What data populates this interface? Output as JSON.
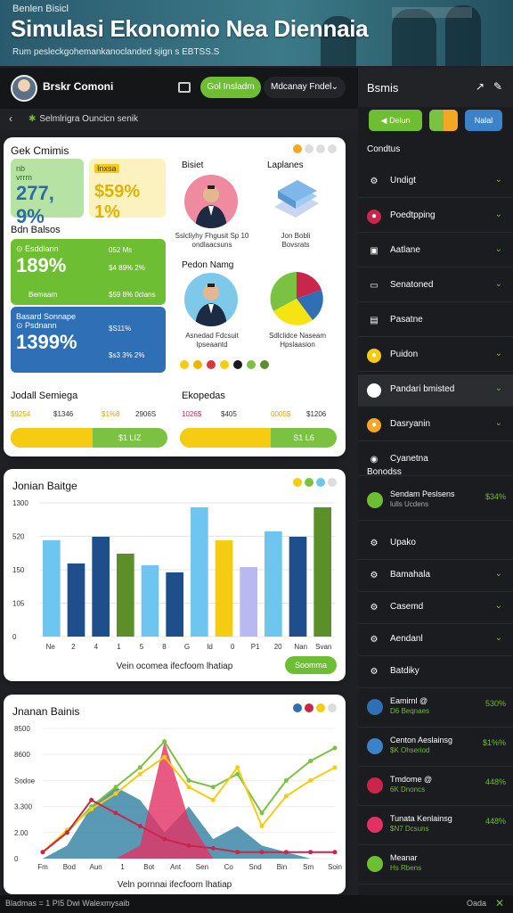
{
  "banner": {
    "kicker": "Benlen Bisicl",
    "title": "Simulasi Ekonomio Nea Diennaia",
    "subtitle": "Rum pesleckgohemankanoclanded sjign s EBTSS.S"
  },
  "topbar": {
    "username": "Brskr Comoni",
    "green_pill": "Gol Insladm",
    "dropdown": "Mdcanay Fndel"
  },
  "breadcrumb": {
    "text": "Selmlrigra Ouncicn senik"
  },
  "card1": {
    "title": "Gek Cmimis",
    "stat1": {
      "label": "nb",
      "sub": "vrrm",
      "value": "277, 9%"
    },
    "stat2": {
      "label": "Inxsa",
      "value": "$59% 1%"
    },
    "section": "Bdn Balsos",
    "green": {
      "label": "Esddlann",
      "value": "189%",
      "r1": "052 Ms",
      "r2": "$4 89% 2%",
      "foot": "Bemaarn",
      "foot_v": "$59 8% 0clans"
    },
    "blue": {
      "label": "Basard Sonnape",
      "sub": "Psdnann",
      "value": "1399%",
      "r1": "$S11%",
      "r2": "$s3 3% 2%"
    },
    "col_bisiet": "Bisiet",
    "col_laplanes": "Laplanes",
    "person1_cap": "Sslcliyhy Fhgusit Sp 10 ondlaacsuns",
    "lap_cap": "Jon Bobli Bovsrats",
    "pie_title": "Pedon Namg",
    "person2_cap": "Asnedad Fdcsuit Ipseaantd",
    "pie_cap": "Sdlclidce Naseam Hpslaasion",
    "jodall": "Jodall Semiega",
    "ekopedas": "Ekopedas",
    "row1": [
      "$9254",
      "$1346",
      "$1%8",
      "2906S"
    ],
    "row2": [
      "1026$",
      "$405",
      "0005$",
      "$1206"
    ],
    "prog1": {
      "fraction": 0.52,
      "value": "$1 LIZ"
    },
    "prog2": {
      "fraction": 0.58,
      "value": "S1 L6"
    }
  },
  "card2": {
    "title": "Jonian Baitge",
    "footer": "Vein ocomea ifecfoom lhatiap",
    "button": "Soomma"
  },
  "card3": {
    "title": "Jnanan Bainis",
    "footer": "Veln pornnai ifecfoom lhatiap"
  },
  "sidebar": {
    "title": "Bsmis",
    "btn1": "Delun",
    "btn3": "Nalal",
    "section1": "Condtus",
    "items": [
      {
        "label": "Undigt"
      },
      {
        "label": "Poedtpping"
      },
      {
        "label": "Aatlane"
      },
      {
        "label": "Senatoned"
      },
      {
        "label": "Pasatne"
      },
      {
        "label": "Puidon"
      },
      {
        "label": "Pandari bmisted"
      },
      {
        "label": "Dasryanin"
      },
      {
        "label": "Cyanetna"
      }
    ],
    "section2": "Bonodss",
    "feature": {
      "name": "Sendam Peslsens",
      "sub": "lulls Ucdens",
      "pct": "$34%"
    },
    "items2": [
      {
        "label": "Upako"
      },
      {
        "label": "Bamahala"
      },
      {
        "label": "Casemd"
      },
      {
        "label": "Aendanl"
      },
      {
        "label": "Batdiky"
      }
    ],
    "rows": [
      {
        "name": "Eamirnl @",
        "sub": "D6 Beqnaes",
        "pct": "530%"
      },
      {
        "name": "Centon Aeslainsg",
        "sub": "$K Ohseriod",
        "pct": "$1%%"
      },
      {
        "name": "Tmdome @",
        "sub": "6K Dnoncs",
        "pct": "448%"
      },
      {
        "name": "Tunata Kenlainsg",
        "sub": "$N7 Dcsuns",
        "pct": "448%"
      },
      {
        "name": "Meanar",
        "sub": "Hs Rbens",
        "pct": ""
      }
    ]
  },
  "bottombar": {
    "left": "Bladmas = 1 PI5 Dwi Walexmysaib",
    "right": "Oada"
  },
  "chart_data": [
    {
      "type": "bar",
      "title": "Jonian Baitge",
      "categories": [
        "Ne",
        "2",
        "4",
        "1",
        "5",
        "8",
        "G",
        "Id",
        "0",
        "P1",
        "20",
        "Nan",
        "Svan"
      ],
      "values": [
        108,
        82,
        112,
        93,
        80,
        72,
        145,
        108,
        78,
        118,
        112,
        145
      ],
      "colors": [
        "#6ec6f0",
        "#1f4e8c",
        "#1f4e8c",
        "#5a8f2a",
        "#6ec6f0",
        "#1f4e8c",
        "#6ec6f0",
        "#f5cc12",
        "#b9b8f0",
        "#6ec6f0",
        "#1f4e8c",
        "#5a8f2a"
      ],
      "yticks": [
        "1300",
        "520",
        "150",
        "105",
        "0"
      ],
      "ylim": [
        0,
        150
      ]
    },
    {
      "type": "line",
      "title": "Jnanan Bainis",
      "categories": [
        "Fm",
        "Bod",
        "Aun",
        "1",
        "Bot",
        "Ant",
        "Sen",
        "Co",
        "Snd",
        "Bin",
        "Sm",
        "Soin"
      ],
      "yticks": [
        "8500",
        "8600",
        "Sodoe",
        "3.300",
        "2.00",
        "0"
      ],
      "ylim": [
        0,
        100
      ],
      "series": [
        {
          "color": "#7cc242",
          "values": [
            5,
            20,
            40,
            55,
            70,
            90,
            60,
            55,
            65,
            35,
            60,
            75,
            85
          ]
        },
        {
          "color": "#f5cc12",
          "values": [
            5,
            22,
            38,
            50,
            65,
            78,
            55,
            45,
            70,
            25,
            48,
            60,
            70
          ]
        },
        {
          "color": "#c8264a",
          "values": [
            5,
            20,
            45,
            35,
            25,
            15,
            10,
            8,
            5,
            5,
            5,
            5,
            5
          ]
        }
      ],
      "areas": [
        {
          "color": "#2f7fa0",
          "values": [
            0,
            10,
            40,
            55,
            45,
            20,
            40,
            15,
            25,
            10,
            5,
            0,
            0
          ]
        },
        {
          "color": "#e33163",
          "values": [
            0,
            0,
            0,
            0,
            10,
            90,
            30,
            0,
            0,
            0,
            0,
            0,
            0
          ]
        }
      ]
    }
  ]
}
